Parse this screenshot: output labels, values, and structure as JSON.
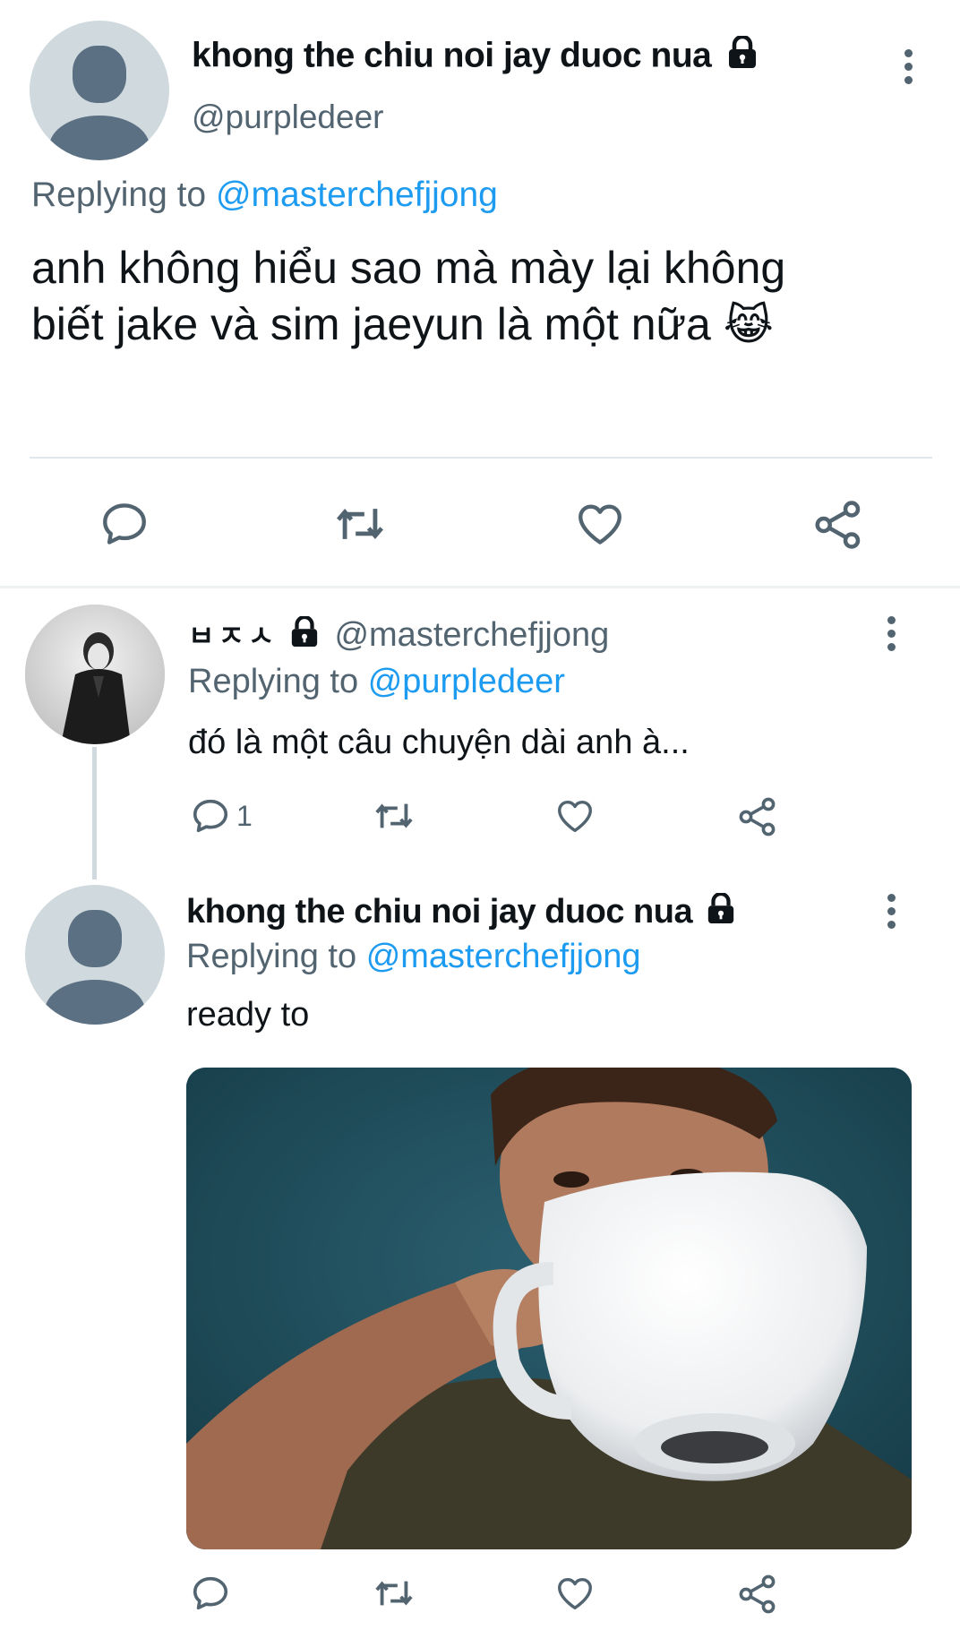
{
  "tweet1": {
    "display_name": "khong the chiu noi jay duoc nua",
    "handle": "@purpledeer",
    "replying_prefix": "Replying to",
    "replying_to": "@masterchefjjong",
    "text_line1": "anh không hiểu sao mà mày lại không",
    "text_line2": "biết jake và sim jaeyun là một nữa",
    "emoji": "😹",
    "locked": true
  },
  "reply1": {
    "display_name": "ㅂㅈㅅ",
    "handle": "@masterchefjjong",
    "replying_prefix": "Replying to",
    "replying_to": "@purpledeer",
    "text": "đó là một câu chuyện dài anh à...",
    "reply_count": "1",
    "locked": true
  },
  "reply2": {
    "display_name": "khong the chiu noi jay duoc nua",
    "replying_prefix": "Replying to",
    "replying_to": "@masterchefjjong",
    "text": "ready to",
    "locked": true
  },
  "icons": {
    "reply": "reply-icon",
    "retweet": "retweet-icon",
    "like": "heart-icon",
    "share": "share-icon",
    "more": "more-vertical-icon",
    "lock": "lock-icon"
  },
  "colors": {
    "text": "#0f1419",
    "muted": "#536471",
    "link": "#1d9bf0",
    "divider": "#e1e8ed",
    "avatar_bg": "#cfd9de",
    "avatar_fg": "#5b7083"
  }
}
